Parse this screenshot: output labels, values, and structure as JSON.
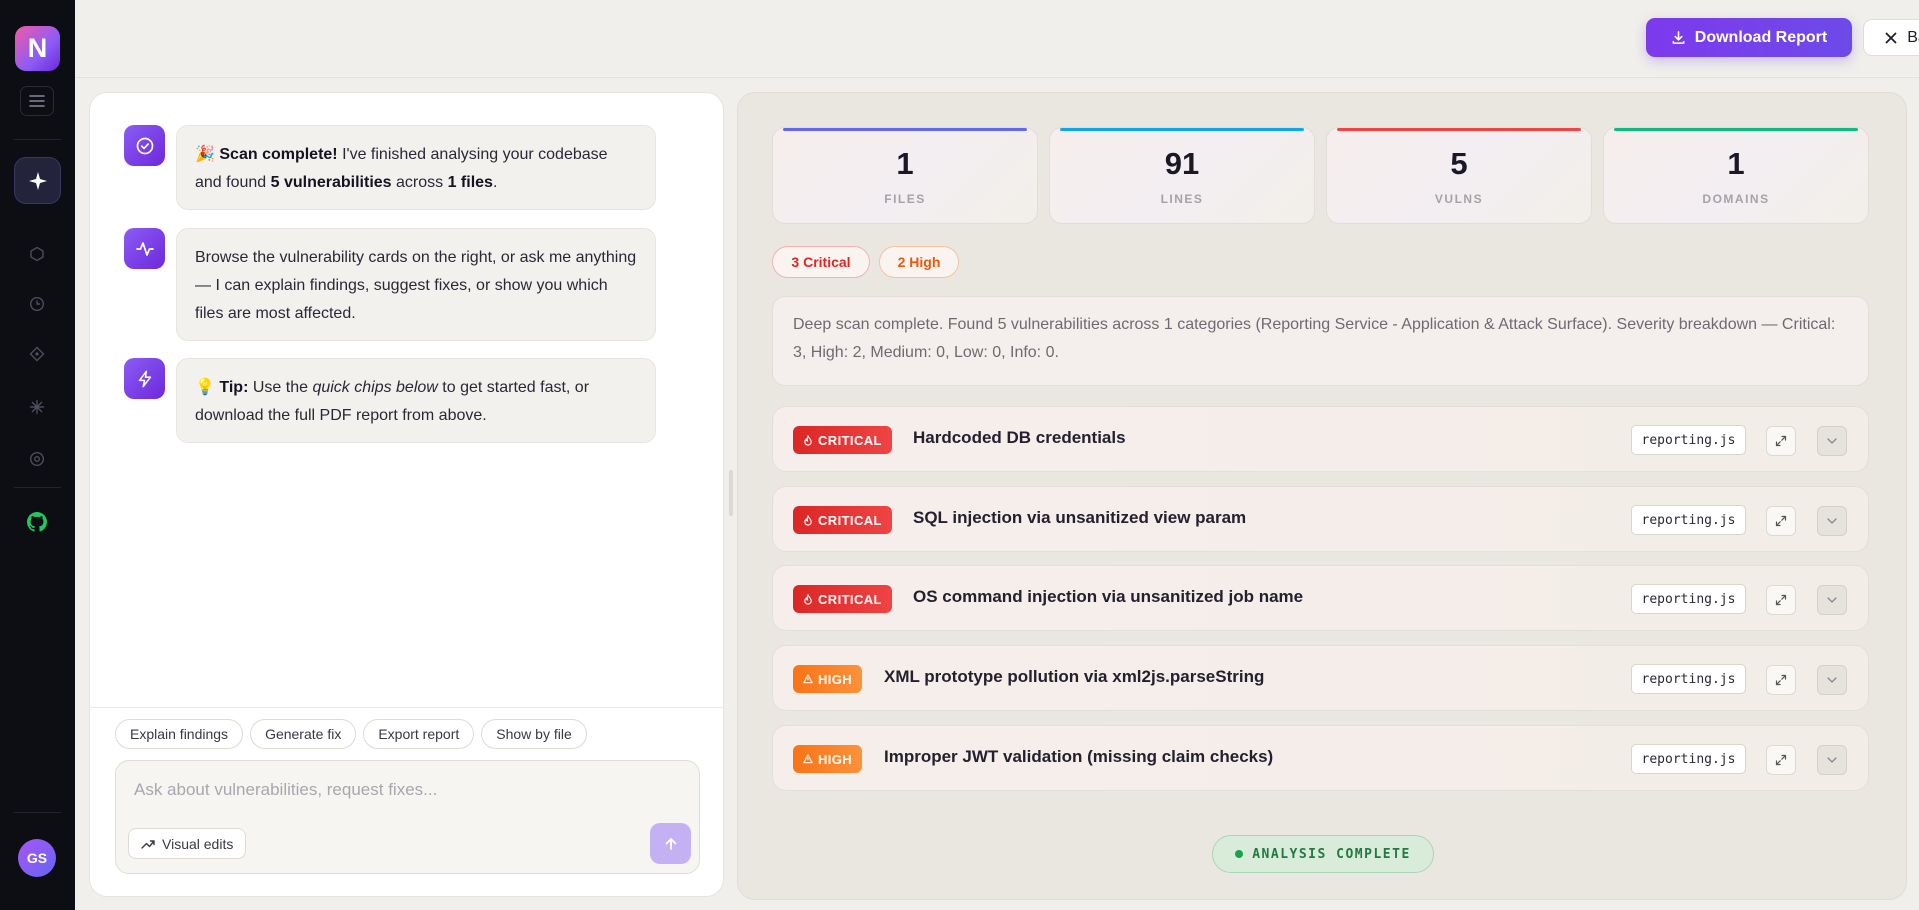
{
  "sidebar": {
    "logo_letter": "N",
    "user_initials": "GS",
    "icons": [
      "menu-icon",
      "sparkle-icon",
      "cube-icon",
      "clock-icon",
      "diamond-icon",
      "asterisk-icon",
      "settings-icon",
      "github-icon"
    ],
    "colors": {
      "background": "#0d0d14",
      "github": "#22c55e"
    }
  },
  "toolbar": {
    "download_label": "Download Report",
    "back_label": "Back",
    "accent_color": "#7c3aed"
  },
  "chat": {
    "messages": [
      {
        "icon": "check-circle-icon",
        "emoji": "🎉",
        "bold_lead": "Scan complete!",
        "text_a": " I've finished analysing your codebase and found ",
        "bold_count": "5 vulnerabilities",
        "text_b": " across ",
        "bold_files": "1 files",
        "text_c": "."
      },
      {
        "icon": "activity-icon",
        "text": "Browse the vulnerability cards on the right, or ask me anything — I can explain findings, suggest fixes, or show you which files are most affected."
      },
      {
        "icon": "bolt-icon",
        "emoji": "💡",
        "bold_lead": "Tip:",
        "text_a": " Use the ",
        "italic": "quick chips below",
        "text_b": " to get started fast, or download the full PDF report from above."
      }
    ],
    "chips": [
      "Explain findings",
      "Generate fix",
      "Export report",
      "Show by file"
    ],
    "input_placeholder": "Ask about vulnerabilities, request fixes...",
    "input_value": "",
    "visual_edits_label": "Visual edits"
  },
  "stats": [
    {
      "value": "1",
      "label": "FILES",
      "color": "#6366f1"
    },
    {
      "value": "91",
      "label": "LINES",
      "color": "#0ea5e9"
    },
    {
      "value": "5",
      "label": "VULNS",
      "color": "#ef4444"
    },
    {
      "value": "1",
      "label": "DOMAINS",
      "color": "#10b981"
    }
  ],
  "severity": {
    "critical_label": "3 Critical",
    "high_label": "2 High",
    "critical_color": "#dc2626",
    "high_color": "#ea580c"
  },
  "summary": "Deep scan complete. Found 5 vulnerabilities across 1 categories (Reporting Service - Application & Attack Surface). Severity breakdown — Critical: 3, High: 2, Medium: 0, Low: 0, Info: 0.",
  "vulnerabilities": [
    {
      "severity": "CRITICAL",
      "level": "critical",
      "title": "Hardcoded DB credentials",
      "file": "reporting.js"
    },
    {
      "severity": "CRITICAL",
      "level": "critical",
      "title": "SQL injection via unsanitized view param",
      "file": "reporting.js"
    },
    {
      "severity": "CRITICAL",
      "level": "critical",
      "title": "OS command injection via unsanitized job name",
      "file": "reporting.js"
    },
    {
      "severity": "HIGH",
      "level": "high",
      "title": "XML prototype pollution via xml2js.parseString",
      "file": "reporting.js"
    },
    {
      "severity": "HIGH",
      "level": "high",
      "title": "Improper JWT validation (missing claim checks)",
      "file": "reporting.js"
    }
  ],
  "status": {
    "label": "ANALYSIS COMPLETE",
    "color": "#16a34a"
  }
}
